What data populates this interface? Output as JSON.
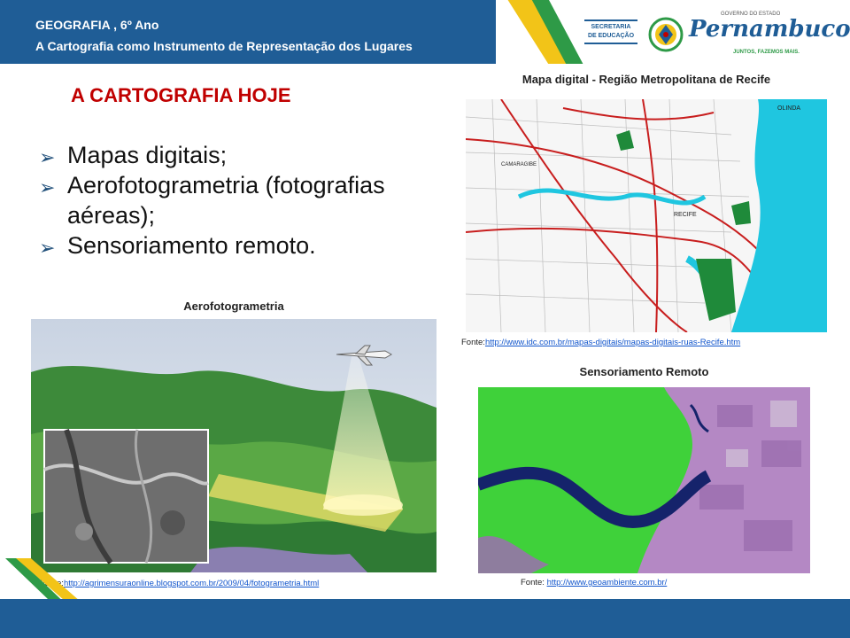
{
  "header": {
    "line1": "GEOGRAFIA , 6º Ano",
    "line2": "A Cartografia como Instrumento de Representação dos Lugares",
    "secretaria_line1": "SECRETARIA",
    "secretaria_line2": "DE EDUCAÇÃO",
    "gov_top": "GOVERNO DO ESTADO",
    "state_name": "Pernambuco",
    "slogan": "JUNTOS, FAZEMOS MAIS."
  },
  "main": {
    "title": "A CARTOGRAFIA HOJE",
    "bullets": [
      "Mapas digitais;",
      "Aerofotogrametria  (fotografias aéreas);",
      "Sensoriamento remoto."
    ]
  },
  "aerofotogrametria": {
    "caption": "Aerofotogrametria",
    "fonte_label": "Fonte:",
    "fonte_url": "http://agrimensuraonline.blogspot.com.br/2009/04/fotogrametria.html"
  },
  "mapa_digital": {
    "caption": "Mapa digital - Região Metropolitana de Recife",
    "fonte_label": "Fonte:",
    "fonte_url": "http://www.idc.com.br/mapas-digitais/mapas-digitais-ruas-Recife.htm",
    "map_labels": [
      "OLINDA",
      "CAMARAGIBE",
      "RECIFE"
    ]
  },
  "sensoriamento": {
    "caption": "Sensoriamento Remoto",
    "fonte_label": "Fonte: ",
    "fonte_url": "http://www.geoambiente.com.br/"
  },
  "colors": {
    "header_blue": "#1f5d96",
    "title_red": "#c00000",
    "stripe_yellow": "#f2c418",
    "stripe_green": "#2e9a47",
    "link_blue": "#1155cc"
  }
}
